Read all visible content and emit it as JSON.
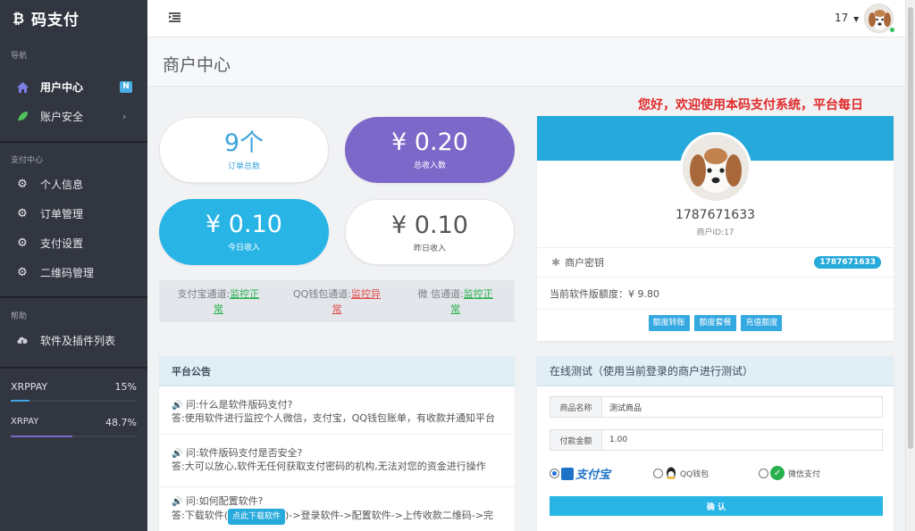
{
  "sidebar": {
    "logo_icon": "bitcoin-icon",
    "logo_text": "码支付",
    "section_nav": "导航",
    "item_user_center": "用户中心",
    "badge_new": "N",
    "item_account_security": "账户安全",
    "section_pay": "支付中心",
    "item_profile": "个人信息",
    "item_orders": "订单管理",
    "item_pay_settings": "支付设置",
    "item_qrcode": "二维码管理",
    "section_help": "帮助",
    "item_software": "软件及插件列表",
    "progress": [
      {
        "label": "XRPPAY",
        "value": "15%",
        "fraction": 0.15,
        "color": "#3ea4de"
      },
      {
        "label": "XRPAY",
        "value": "48.7%",
        "fraction": 0.487,
        "color": "#7b68c9"
      }
    ]
  },
  "topbar": {
    "menu_icon": "menu-icon",
    "count": "17",
    "dropdown_icon": "caret-down-icon"
  },
  "page": {
    "title": "商户中心"
  },
  "stats": [
    {
      "value": "9个",
      "label": "订单总数",
      "bg": "#ffffff",
      "fg": "#3ea4de"
    },
    {
      "value": "¥ 0.20",
      "label": "总收入数",
      "bg": "#7b68c9",
      "fg": "#ffffff"
    },
    {
      "value": "¥ 0.10",
      "label": "今日收入",
      "bg": "#29b4e6",
      "fg": "#ffffff"
    },
    {
      "value": "¥ 0.10",
      "label": "昨日收入",
      "bg": "#ffffff",
      "fg": "#555555"
    }
  ],
  "channels": [
    {
      "name": "支付宝通道:",
      "status_a": "监控正",
      "status_b": "常",
      "color": "#27b04c"
    },
    {
      "name": "QQ钱包通道:",
      "status_a": "监控异",
      "status_b": "常",
      "color": "#e34a4a"
    },
    {
      "name": "微 信通道:",
      "status_a": "监控正",
      "status_b": "常",
      "color": "#27b04c"
    }
  ],
  "marquee": "您好，欢迎使用本码支付系统，平台每日",
  "profile": {
    "header_color": "#26a9db",
    "merchant_number": "1787671633",
    "merchant_id": "商户ID:17",
    "key_label": "商户密钥",
    "key_badge": "1787671633",
    "quota_label": "当前软件版额度：",
    "quota_value": "¥ 9.80",
    "buttons": [
      "额度转账",
      "额度套餐",
      "充值额度"
    ]
  },
  "notices": {
    "title": "平台公告",
    "items": [
      {
        "q": "问:什么是软件版码支付?",
        "a": "答:使用软件进行监控个人微信，支付宝，QQ钱包账单，有收款并通知平台"
      },
      {
        "q": "问:软件版码支付是否安全?",
        "a": "答:大可以放心,软件无任何获取支付密码的机构,无法对您的资金进行操作"
      },
      {
        "q": "问:如何配置软件?",
        "a_pre": "答:下载软件(",
        "a_btn": "点此下载软件",
        "a_post": ")->登录软件->配置软件->上传收款二维码->完"
      }
    ]
  },
  "test": {
    "title": "在线测试（使用当前登录的商户进行测试）",
    "goods_label": "商品名称",
    "goods_value": "测试商品",
    "amount_label": "付款金额",
    "amount_value": "1.00",
    "pay_alipay": "支付宝",
    "pay_qq": "QQ钱包",
    "pay_wechat": "微信支付",
    "confirm": "确 认"
  }
}
